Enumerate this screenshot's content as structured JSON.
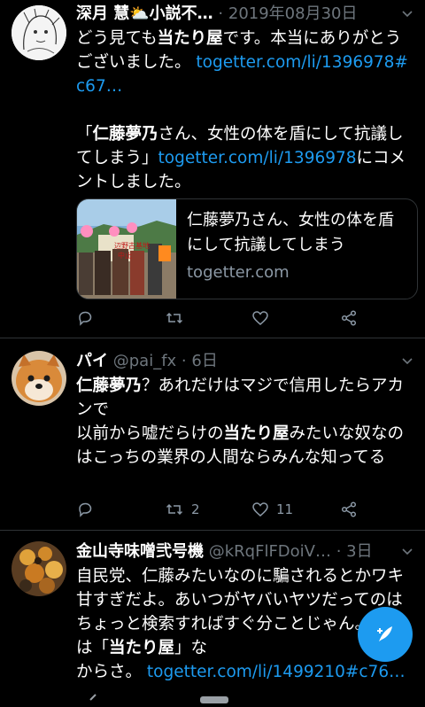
{
  "colors": {
    "accent": "#1d9bf0",
    "background": "#000000",
    "muted": "#6e767d"
  },
  "tweets": [
    {
      "name": "深月 慧⛅小説不…",
      "handle": "",
      "time": "· 2019年08月30日",
      "body": {
        "p1_a": "どう見ても",
        "p1_bold": "当たり屋",
        "p1_b": "です。本当にありがとうございました。",
        "p1_link": "togetter.com/li/1396978#c67…",
        "p2_a": "「",
        "p2_bold": "仁藤夢乃",
        "p2_b": "さん、女性の体を盾にして抗議してしまう」",
        "p2_link": "togetter.com/li/1396978",
        "p2_c": "にコメントしました。"
      },
      "card": {
        "title": "仁藤夢乃さん、女性の体を盾にして抗議してしまう",
        "domain": "togetter.com",
        "sign_text_1": "辺野古基地",
        "sign_text_2": "中止"
      },
      "actions": {
        "reply_count": "",
        "retweet_count": "",
        "like_count": ""
      }
    },
    {
      "name": "パイ",
      "handle": "@pai_fx",
      "time": "· 6日",
      "body": {
        "p1_bold": "仁藤夢乃",
        "p1_a": "？あれだけはマジで信用したらアカンで",
        "p2_a": "以前から嘘だらけの",
        "p2_bold": "当たり屋",
        "p2_b": "みたいな奴なのはこっちの業界の人間ならみんな知ってる"
      },
      "actions": {
        "reply_count": "",
        "retweet_count": "2",
        "like_count": "11"
      }
    },
    {
      "name": "金山寺味噌弐号機",
      "handle": "@kRqFlFDoiV…",
      "time": "· 3日",
      "body": {
        "p1_a": "自民党、仁藤みたいなのに騙されるとかワキ甘すぎだよ。あいつがヤバいヤツだってのはちょっと検索すればすぐ分",
        "p1_b": "ことじゃん。仁藤は「",
        "p1_bold": "当たり屋",
        "p1_c": "」な",
        "p1_d": "からさ。",
        "p1_link": "togetter.com/li/1499210#c76…"
      }
    }
  ]
}
